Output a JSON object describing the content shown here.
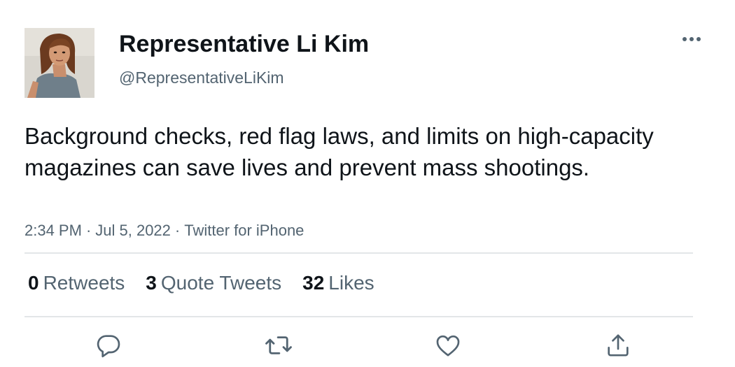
{
  "user": {
    "display_name": "Representative Li Kim",
    "handle": "@RepresentativeLiKim",
    "avatar": "profile-photo"
  },
  "tweet": {
    "text": "Background checks, red flag laws, and limits on high-capacity magazines can save lives and prevent mass shootings.",
    "time": "2:34 PM",
    "date": "Jul 5, 2022",
    "source": "Twitter for iPhone",
    "separator": "·"
  },
  "stats": {
    "retweets_count": "0",
    "retweets_label": "Retweets",
    "quotes_count": "3",
    "quotes_label": "Quote Tweets",
    "likes_count": "32",
    "likes_label": "Likes"
  },
  "actions": [
    {
      "icon": "reply-icon"
    },
    {
      "icon": "retweet-icon"
    },
    {
      "icon": "like-icon"
    },
    {
      "icon": "share-icon"
    }
  ],
  "colors": {
    "text_primary": "#0f1419",
    "text_secondary": "#536471",
    "divider": "#e3e6e8",
    "icon": "#536471"
  }
}
